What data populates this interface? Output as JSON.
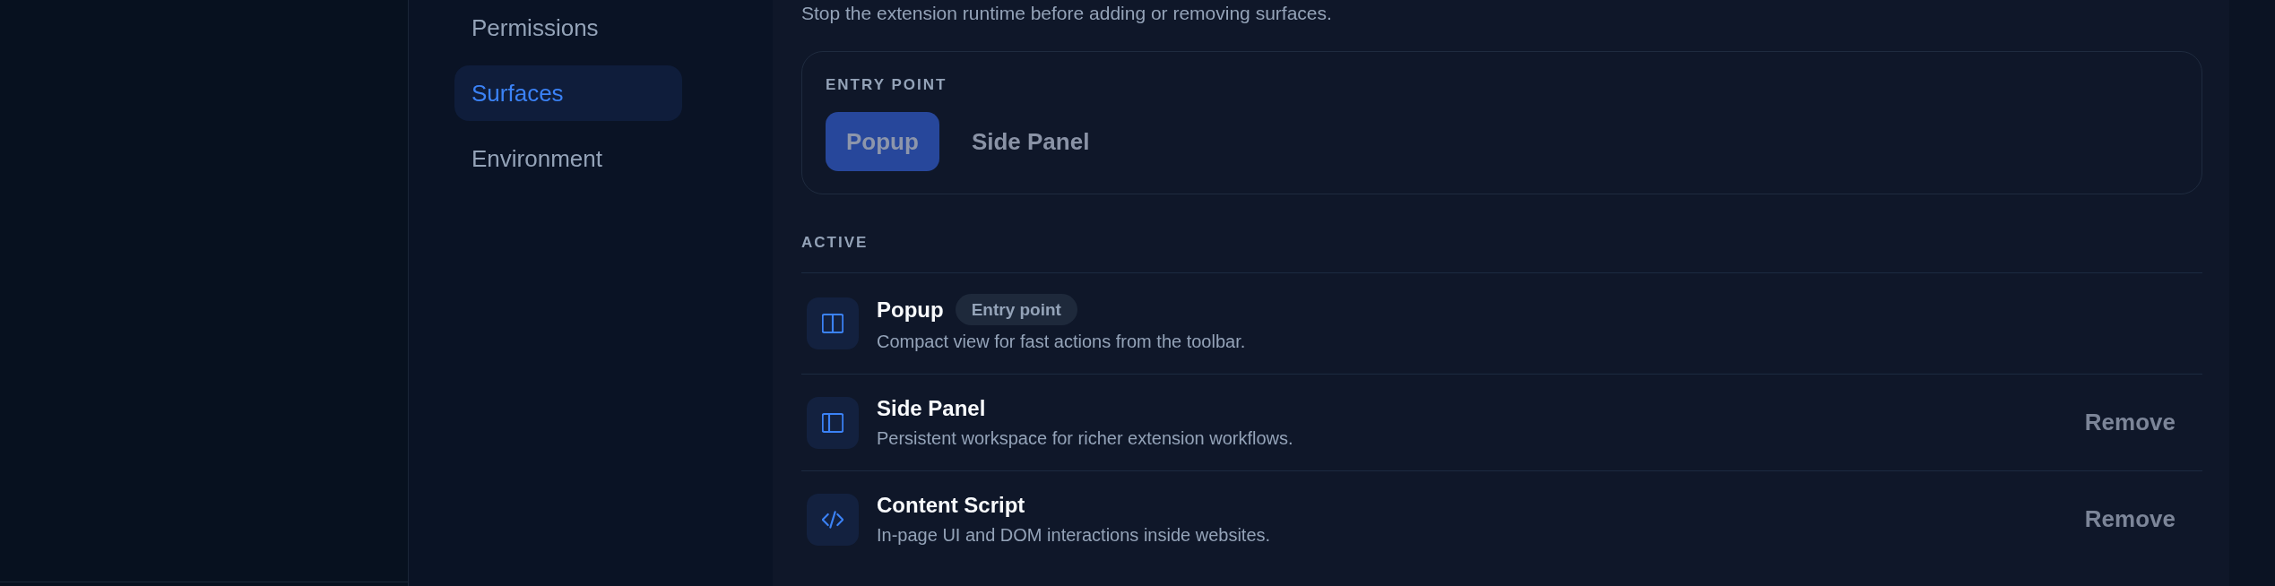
{
  "sidebar": {
    "items": [
      {
        "label": "Permissions",
        "selected": false
      },
      {
        "label": "Surfaces",
        "selected": true
      },
      {
        "label": "Environment",
        "selected": false
      }
    ]
  },
  "description": "Stop the extension runtime before adding or removing surfaces.",
  "entry_point": {
    "label": "ENTRY POINT",
    "disabled": true,
    "options": [
      {
        "label": "Popup",
        "selected": true
      },
      {
        "label": "Side Panel",
        "selected": false
      }
    ]
  },
  "active": {
    "label": "ACTIVE",
    "surfaces": [
      {
        "name": "Popup",
        "badge": "Entry point",
        "description": "Compact view for fast actions from the toolbar."
      },
      {
        "name": "Side Panel",
        "description": "Persistent workspace for richer extension workflows.",
        "action": {
          "label": "Remove",
          "disabled": true
        }
      },
      {
        "name": "Content Script",
        "description": "In-page UI and DOM interactions inside websites.",
        "action": {
          "label": "Remove",
          "disabled": true
        }
      }
    ]
  }
}
